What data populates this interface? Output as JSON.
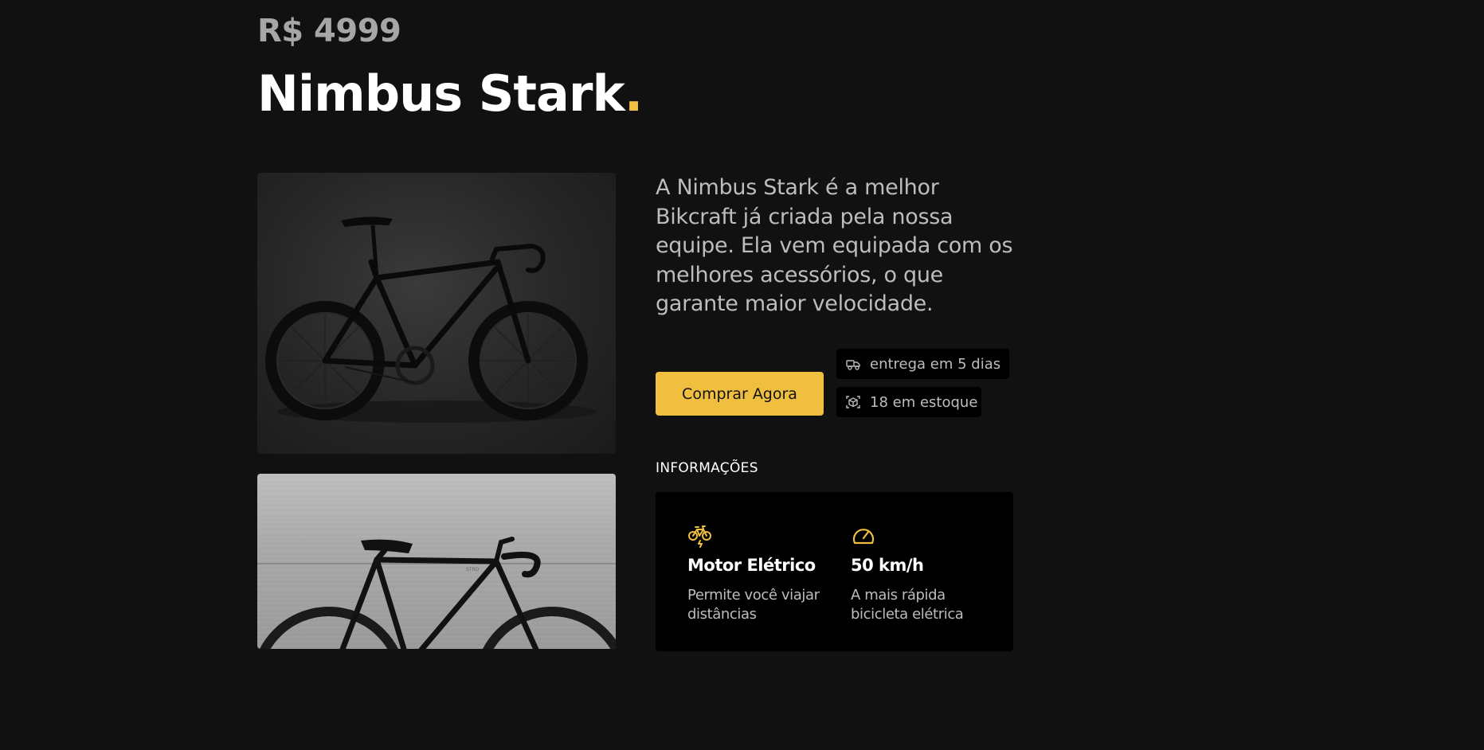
{
  "product": {
    "price": "R$ 4999",
    "name": "Nimbus Stark",
    "name_dot": ".",
    "description": "A Nimbus Stark é a melhor Bikcraft já criada pela nossa equipe. Ela vem equipada com os melhores acessórios, o que garante maior velocidade."
  },
  "actions": {
    "buy_label": "Comprar Agora"
  },
  "tags": {
    "delivery": {
      "icon": "delivery-truck-icon",
      "label": "entrega em 5 dias"
    },
    "stock": {
      "icon": "package-box-icon",
      "label": "18 em estoque"
    }
  },
  "info": {
    "heading": "INFORMAÇÕES",
    "features": [
      {
        "icon": "electric-bike-icon",
        "title": "Motor Elétrico",
        "text": "Permite você viajar distâncias"
      },
      {
        "icon": "speedometer-icon",
        "title": "50 km/h",
        "text": "A mais rápida bicicleta elétrica"
      }
    ]
  },
  "colors": {
    "background": "#111111",
    "accent": "#f0bf40",
    "text_muted": "#bdbdbd",
    "card": "#000000"
  }
}
